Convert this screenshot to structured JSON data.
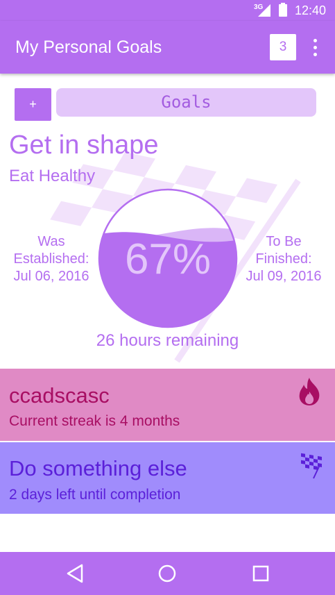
{
  "status_bar": {
    "network": "3G",
    "time": "12:40"
  },
  "app_bar": {
    "title": "My Personal Goals",
    "count": "3",
    "menu_icon": "more-vert-icon"
  },
  "toolbar": {
    "add_label": "+",
    "goals_tab_label": "Goals"
  },
  "featured_goal": {
    "title": "Get in shape",
    "subtitle": "Eat Healthy",
    "established_label_1": "Was",
    "established_label_2": "Established:",
    "established_date": "Jul 06, 2016",
    "finish_label_1": "To Be",
    "finish_label_2": "Finished:",
    "finish_date": "Jul 09, 2016",
    "progress_percent": 67,
    "progress_text": "67%",
    "remaining": "26 hours remaining"
  },
  "goal_cards": [
    {
      "title": "ccadscasc",
      "subtitle": "Current streak is 4 months",
      "icon": "flame-icon",
      "color": "#e08ac5",
      "text_color": "#a80e63"
    },
    {
      "title": "Do something else",
      "subtitle": "2 days left until completion",
      "icon": "checkered-flag-icon",
      "color": "#a08cfc",
      "text_color": "#5b20d9"
    }
  ],
  "nav_bar": {
    "back_icon": "back-triangle-icon",
    "home_icon": "home-circle-icon",
    "recents_icon": "recents-square-icon"
  },
  "colors": {
    "accent": "#b46ef0",
    "accent_light": "#e3c6fa"
  }
}
